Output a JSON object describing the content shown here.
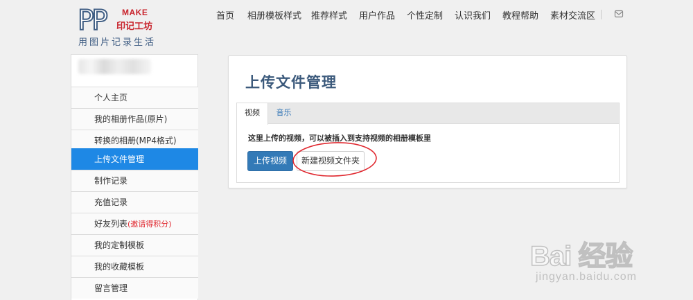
{
  "logo": {
    "letters": "PP",
    "make": "MAKE",
    "name": "印记工坊",
    "slogan": "用图片记录生活"
  },
  "nav": {
    "items": [
      {
        "label": "首页"
      },
      {
        "label": "相册模板样式"
      },
      {
        "label": "推荐样式"
      },
      {
        "label": "用户作品"
      },
      {
        "label": "个性定制"
      },
      {
        "label": "认识我们"
      },
      {
        "label": "教程帮助"
      },
      {
        "label": "素材交流区"
      }
    ],
    "mail_icon": "envelope-icon"
  },
  "sidebar": {
    "items": [
      {
        "label": "个人主页"
      },
      {
        "label": "我的相册作品(原片)"
      },
      {
        "label": "转换的相册(MP4格式)"
      },
      {
        "label": "上传文件管理",
        "active": true
      },
      {
        "label": "制作记录"
      },
      {
        "label": "充值记录"
      },
      {
        "label": "好友列表",
        "note": "(邀请得积分)"
      },
      {
        "label": "我的定制模板"
      },
      {
        "label": "我的收藏模板"
      },
      {
        "label": "留言管理"
      }
    ]
  },
  "main": {
    "title": "上传文件管理",
    "tabs": [
      {
        "label": "视频",
        "active": true
      },
      {
        "label": "音乐",
        "active": false
      }
    ],
    "description": "这里上传的视频，可以被插入到支持视频的相册模板里",
    "upload_button": "上传视频",
    "new_folder_button": "新建视频文件夹"
  },
  "annotation": {
    "ring_color": "#e0282f"
  },
  "watermark": {
    "line1": "Bai 经验",
    "line2": "jingyan.baidu.com"
  },
  "colors": {
    "accent": "#1e88e5",
    "primary_button": "#337ab7",
    "title": "#3c5a7c",
    "background": "#f0f0f0"
  }
}
